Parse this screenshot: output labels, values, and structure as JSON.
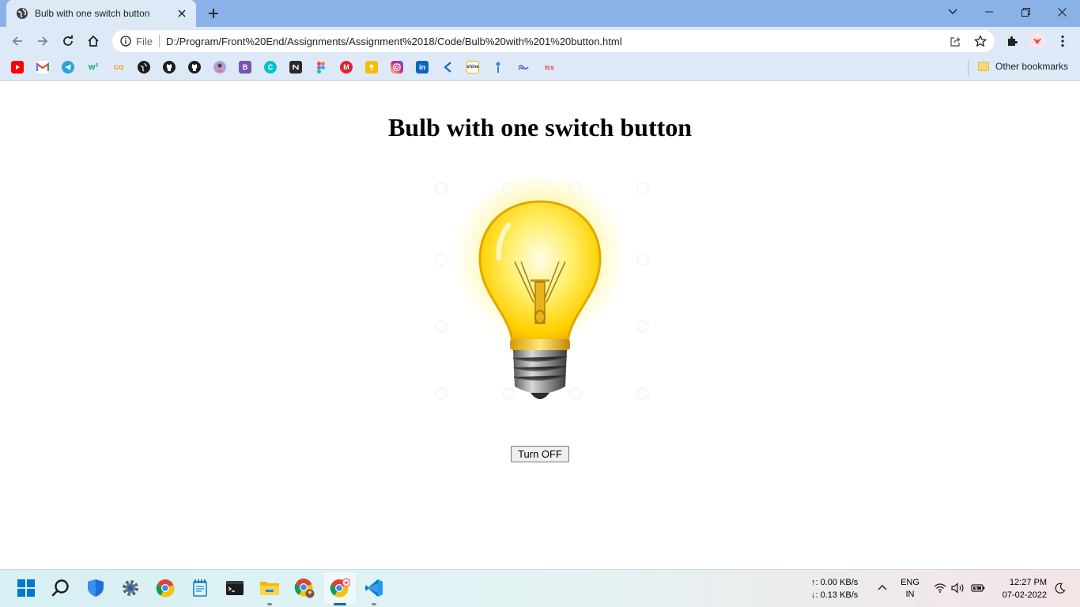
{
  "browser": {
    "tab": {
      "title": "Bulb with one switch button",
      "favicon": "globe-icon"
    },
    "address": {
      "scheme_label": "File",
      "url": "D:/Program/Front%20End/Assignments/Assignment%2018/Code/Bulb%20with%201%20button.html"
    },
    "bookmarks": {
      "items": [
        "youtube",
        "gmail",
        "telegram",
        "w3schools",
        "coursera",
        "globe",
        "github",
        "github",
        "avatar",
        "bootstrap",
        "canva",
        "notion",
        "figma",
        "mcafee",
        "keep",
        "instagram",
        "linkedin",
        "kotlin",
        "shine",
        "freelancer",
        "stack",
        "tcs"
      ],
      "other_label": "Other bookmarks"
    }
  },
  "page": {
    "title": "Bulb with one switch button",
    "button_label": "Turn OFF",
    "bulb_state": "on"
  },
  "taskbar": {
    "net_up": "↑: 0.00 KB/s",
    "net_down": "↓: 0.13 KB/s",
    "lang_top": "ENG",
    "lang_bottom": "IN",
    "time": "12:27 PM",
    "date": "07-02-2022"
  },
  "colors": {
    "tabstrip": "#8ab1e8",
    "toolbar": "#dee9f8",
    "bulb_glow": "#fff7a8",
    "bulb_glass": "#ffd400"
  }
}
